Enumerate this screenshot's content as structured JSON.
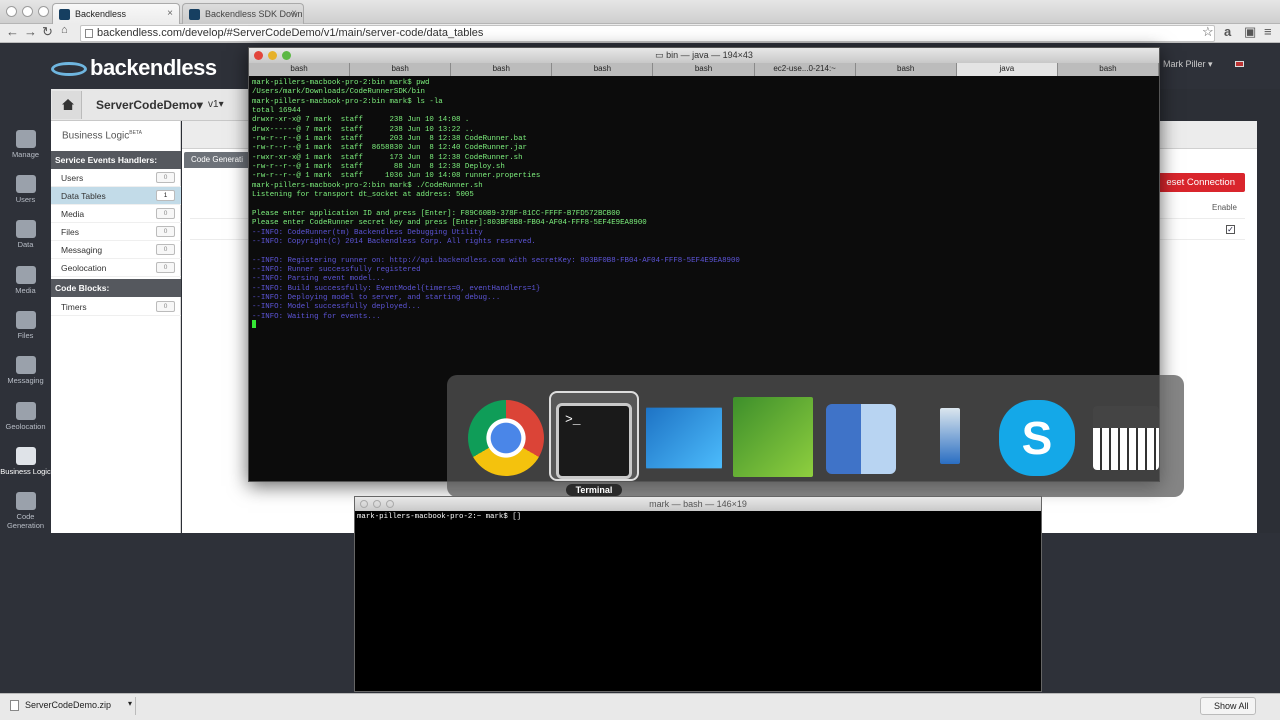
{
  "browser": {
    "tabs": [
      {
        "title": "Backendless"
      },
      {
        "title": "Backendless SDK Downloa"
      }
    ],
    "url": "backendless.com/develop/#ServerCodeDemo/v1/main/server-code/data_tables"
  },
  "app": {
    "logo_text": "backendless",
    "user_name": "Mark Piller",
    "app_name": "ServerCodeDemo",
    "version": "v1",
    "business_logic_title": "Business Logic",
    "beta_label": "BETA",
    "left_nav": [
      {
        "label": "Manage",
        "icon": "gear-icon"
      },
      {
        "label": "Users",
        "icon": "users-icon"
      },
      {
        "label": "Data",
        "icon": "database-icon"
      },
      {
        "label": "Media",
        "icon": "media-icon"
      },
      {
        "label": "Files",
        "icon": "folder-icon"
      },
      {
        "label": "Messaging",
        "icon": "envelope-icon"
      },
      {
        "label": "Geolocation",
        "icon": "pin-icon"
      },
      {
        "label": "Business Logic",
        "icon": "code-icon"
      },
      {
        "label": "Code Generation",
        "icon": "gears-icon"
      }
    ],
    "service_events_header": "Service Events Handlers:",
    "service_events": [
      {
        "label": "Users",
        "count": "0"
      },
      {
        "label": "Data Tables",
        "count": "1"
      },
      {
        "label": "Media",
        "count": "0"
      },
      {
        "label": "Files",
        "count": "0"
      },
      {
        "label": "Messaging",
        "count": "0"
      },
      {
        "label": "Geolocation",
        "count": "0"
      }
    ],
    "code_blocks_header": "Code Blocks:",
    "code_blocks": [
      {
        "label": "Timers",
        "count": "0"
      }
    ],
    "code_gen_tab": "Code Generati",
    "reset_button": "eset Connection",
    "enable_label": "Enable"
  },
  "terminal": {
    "title": "bin — java — 194×43",
    "tabs": [
      "bash",
      "bash",
      "bash",
      "bash",
      "bash",
      "ec2-use...0-214:~",
      "bash",
      "java",
      "bash"
    ],
    "selected_tab": 7,
    "lines": [
      {
        "t": "mark-pillers-macbook-pro-2:bin mark$ pwd"
      },
      {
        "t": "/Users/mark/Downloads/CodeRunnerSDK/bin"
      },
      {
        "t": "mark-pillers-macbook-pro-2:bin mark$ ls -la"
      },
      {
        "t": "total 16944"
      },
      {
        "t": "drwxr-xr-x@ 7 mark  staff      238 Jun 10 14:08 ."
      },
      {
        "t": "drwx------@ 7 mark  staff      238 Jun 10 13:22 .."
      },
      {
        "t": "-rw-r--r--@ 1 mark  staff      203 Jun  8 12:38 CodeRunner.bat"
      },
      {
        "t": "-rw-r--r--@ 1 mark  staff  8658830 Jun  8 12:40 CodeRunner.jar"
      },
      {
        "t": "-rwxr-xr-x@ 1 mark  staff      173 Jun  8 12:38 CodeRunner.sh"
      },
      {
        "t": "-rw-r--r--@ 1 mark  staff       88 Jun  8 12:38 Deploy.sh"
      },
      {
        "t": "-rw-r--r--@ 1 mark  staff     1036 Jun 10 14:08 runner.properties"
      },
      {
        "t": "mark-pillers-macbook-pro-2:bin mark$ ./CodeRunner.sh"
      },
      {
        "t": "Listening for transport dt_socket at address: 5005"
      },
      {
        "t": ""
      },
      {
        "t": "Please enter application ID and press [Enter]: F89C60B9-378F-81CC-FFFF-B7FD572BCB00"
      },
      {
        "t": "Please enter CodeRunner secret key and press [Enter]:803BF0B8-FB04-AF04-FFF8-5EF4E9EA8900"
      },
      {
        "t": "--INFO: CodeRunner(tm) Backendless Debugging Utility",
        "c": "info"
      },
      {
        "t": "--INFO: Copyright(C) 2014 Backendless Corp. All rights reserved.",
        "c": "info"
      },
      {
        "t": ""
      },
      {
        "t": "--INFO: Registering runner on: http://api.backendless.com with secretKey: 803BF0B8-FB04-AF04-FFF8-5EF4E9EA8900",
        "c": "info"
      },
      {
        "t": "--INFO: Runner successfully registered",
        "c": "info"
      },
      {
        "t": "--INFO: Parsing event model...",
        "c": "info"
      },
      {
        "t": "--INFO: Build successfully: EventModel{timers=0, eventHandlers=1}",
        "c": "info"
      },
      {
        "t": "--INFO: Deploying model to server, and starting debug...",
        "c": "info"
      },
      {
        "t": "--INFO: Model successfully deployed...",
        "c": "info"
      },
      {
        "t": "--INFO: Waiting for events...",
        "c": "info"
      }
    ]
  },
  "switcher": {
    "selected_label": "Terminal",
    "terminal_glyph": ">_",
    "apps": [
      "chrome-icon",
      "terminal-icon",
      "intellij-icon",
      "camtasia-icon",
      "finder-icon",
      "xcode-icon",
      "skype-icon",
      "piano-icon"
    ]
  },
  "terminal2": {
    "title": "mark — bash — 146×19",
    "prompt": "mark-pillers-macbook-pro-2:~ mark$ []"
  },
  "downloads": {
    "file": "ServerCodeDemo.zip",
    "show_all": "Show All"
  }
}
